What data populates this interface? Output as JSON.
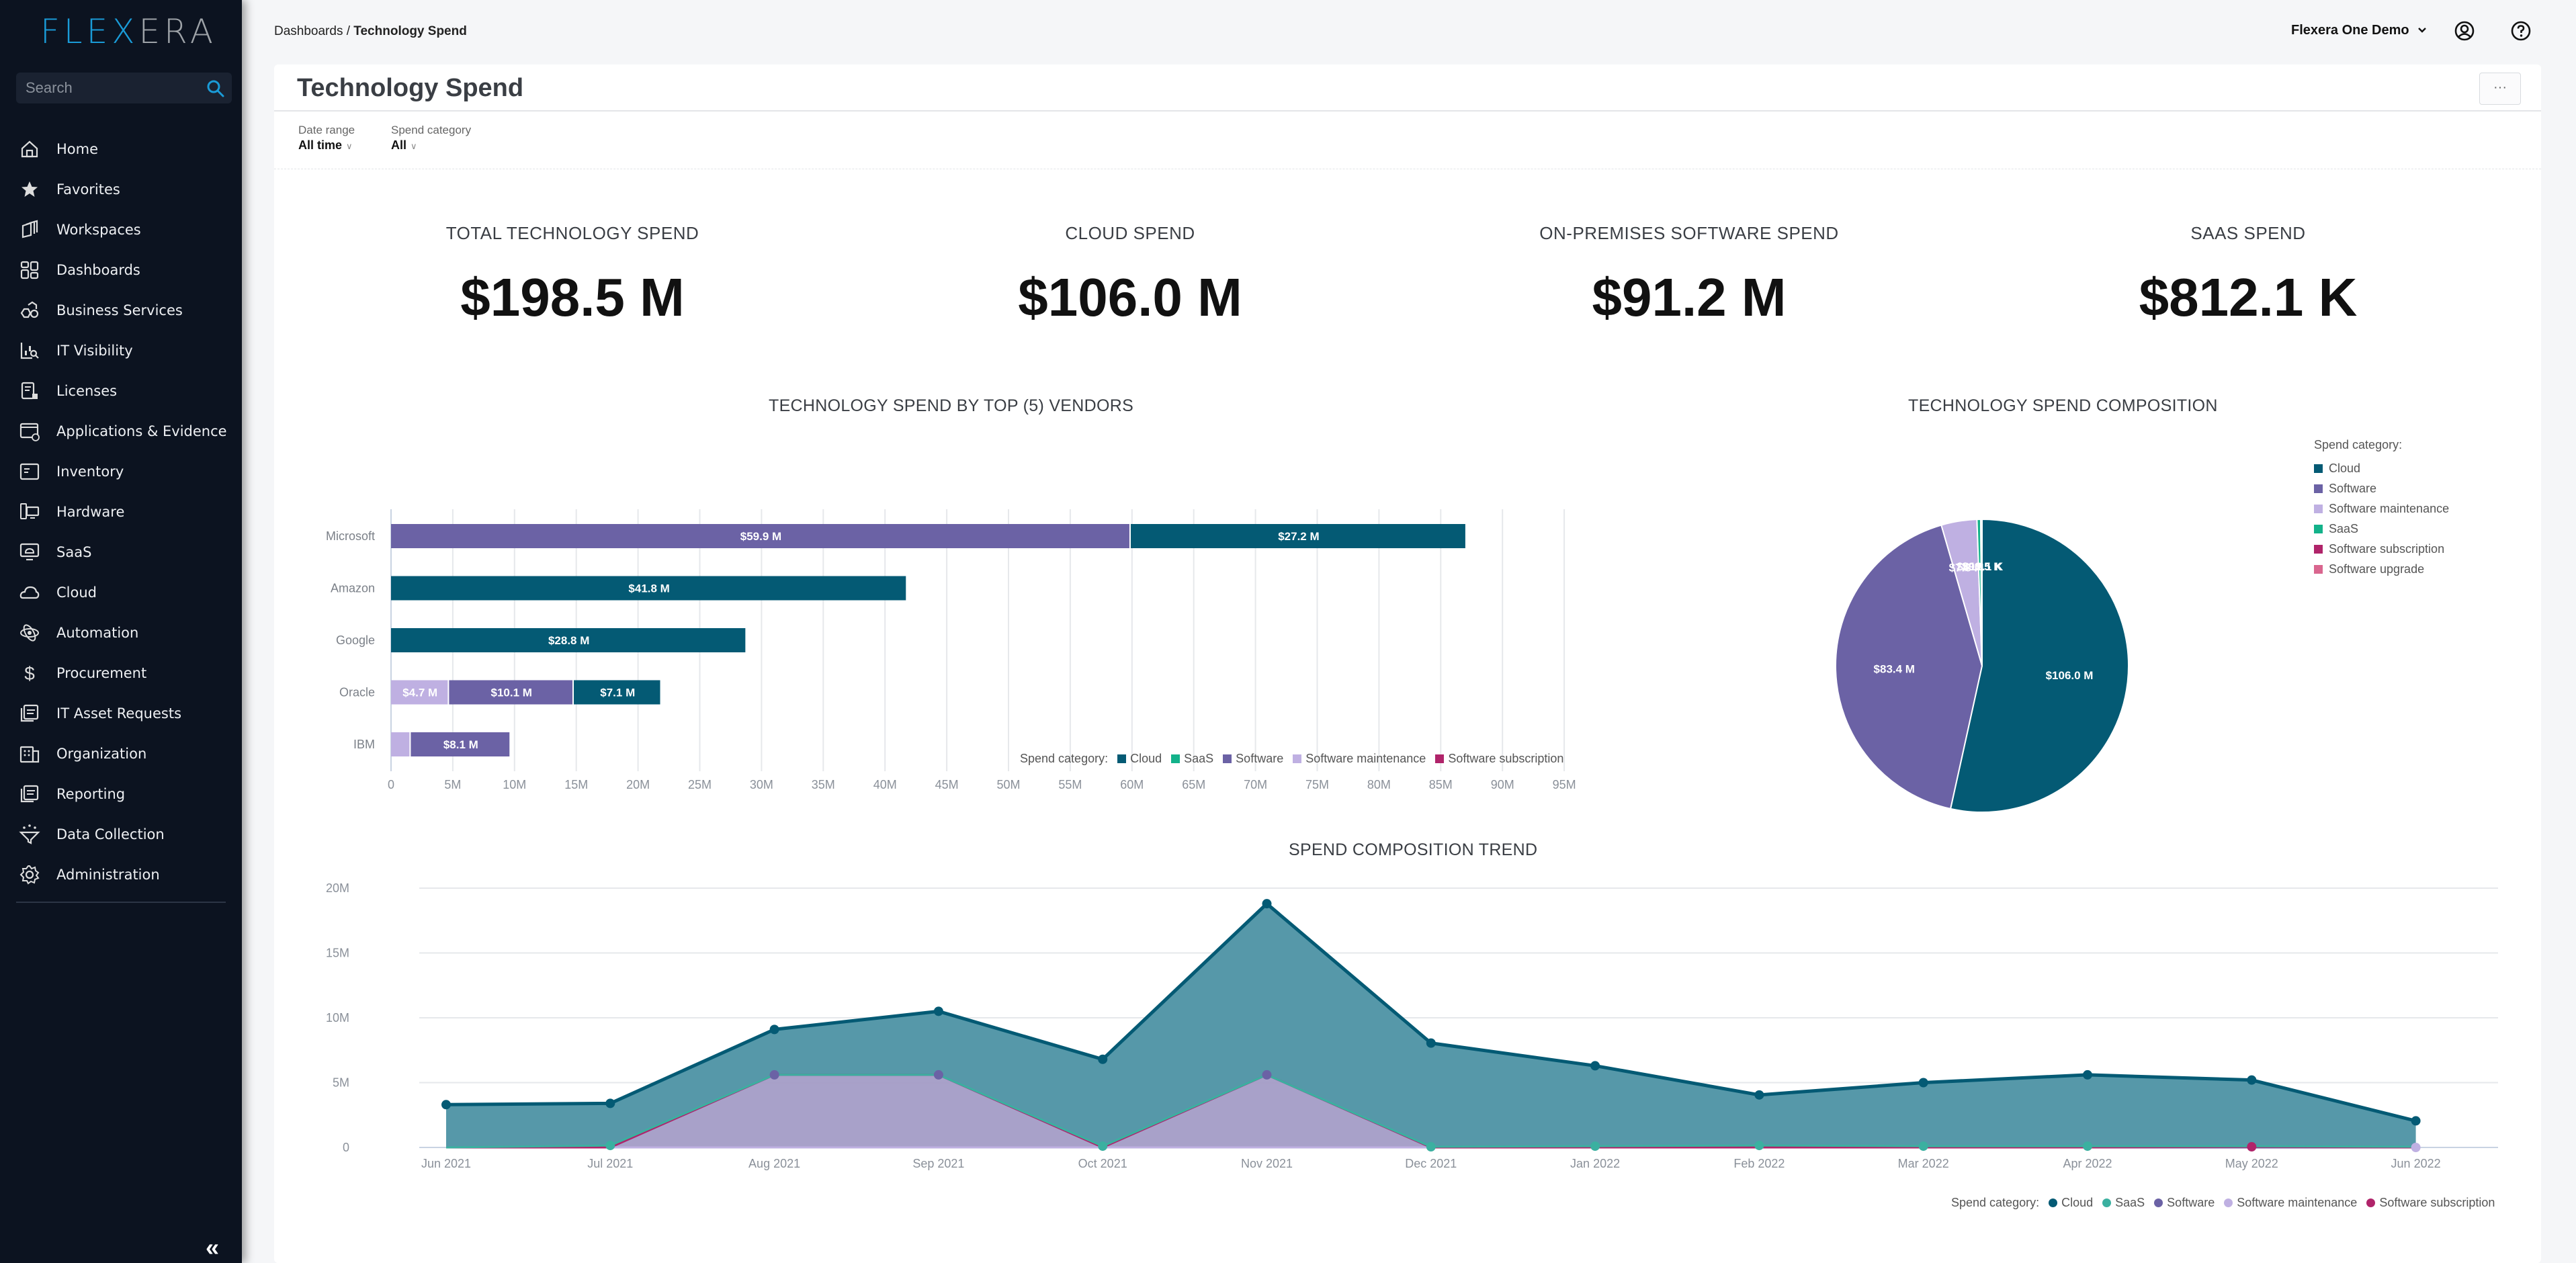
{
  "app": {
    "logo_part1": "FLEX",
    "logo_part2": "ERA"
  },
  "sidebar": {
    "search_placeholder": "Search",
    "items": [
      {
        "label": "Home",
        "icon": "home-icon"
      },
      {
        "label": "Favorites",
        "icon": "star-icon"
      },
      {
        "label": "Workspaces",
        "icon": "workspaces-icon"
      },
      {
        "label": "Dashboards",
        "icon": "dashboards-icon"
      },
      {
        "label": "Business Services",
        "icon": "business-services-icon"
      },
      {
        "label": "IT Visibility",
        "icon": "it-visibility-icon"
      },
      {
        "label": "Licenses",
        "icon": "licenses-icon"
      },
      {
        "label": "Applications & Evidence",
        "icon": "applications-icon"
      },
      {
        "label": "Inventory",
        "icon": "inventory-icon"
      },
      {
        "label": "Hardware",
        "icon": "hardware-icon"
      },
      {
        "label": "SaaS",
        "icon": "saas-icon"
      },
      {
        "label": "Cloud",
        "icon": "cloud-icon"
      },
      {
        "label": "Automation",
        "icon": "automation-icon"
      },
      {
        "label": "Procurement",
        "icon": "dollar-icon"
      },
      {
        "label": "IT Asset Requests",
        "icon": "requests-icon"
      },
      {
        "label": "Organization",
        "icon": "organization-icon"
      },
      {
        "label": "Reporting",
        "icon": "reporting-icon"
      },
      {
        "label": "Data Collection",
        "icon": "data-collection-icon"
      },
      {
        "label": "Administration",
        "icon": "gear-icon"
      }
    ],
    "collapse_label": "«"
  },
  "topbar": {
    "breadcrumb_parent": "Dashboards",
    "breadcrumb_sep": " / ",
    "breadcrumb_current": "Technology Spend",
    "org_name": "Flexera One Demo"
  },
  "page": {
    "title": "Technology Spend",
    "more_label": "···",
    "filters": [
      {
        "label": "Date range",
        "value": "All time"
      },
      {
        "label": "Spend category",
        "value": "All"
      }
    ]
  },
  "kpis": [
    {
      "label": "TOTAL TECHNOLOGY SPEND",
      "value": "$198.5 M"
    },
    {
      "label": "CLOUD SPEND",
      "value": "$106.0 M"
    },
    {
      "label": "ON-PREMISES SOFTWARE SPEND",
      "value": "$91.2 M"
    },
    {
      "label": "SAAS SPEND",
      "value": "$812.1 K"
    }
  ],
  "colors": {
    "Cloud": "#045a74",
    "SaaS": "#13b28a",
    "SaaS_trend": "#3bb0a0",
    "Software": "#6b62a5",
    "Software maintenance": "#bfb0e2",
    "Software subscription": "#b0246a",
    "Software upgrade": "#d9668f"
  },
  "chart_data": [
    {
      "type": "bar",
      "orientation": "horizontal",
      "stacked": true,
      "title": "TECHNOLOGY SPEND BY TOP (5) VENDORS",
      "categories": [
        "Microsoft",
        "Amazon",
        "Google",
        "Oracle",
        "IBM"
      ],
      "series": [
        {
          "name": "Software maintenance",
          "values": [
            0,
            0,
            0,
            4.7,
            1.6
          ],
          "labels": [
            "",
            "",
            "",
            "$4.7 M",
            ""
          ]
        },
        {
          "name": "Software",
          "values": [
            59.9,
            0,
            0,
            10.1,
            8.1
          ],
          "labels": [
            "$59.9 M",
            "",
            "",
            "$10.1 M",
            "$8.1 M"
          ]
        },
        {
          "name": "Cloud",
          "values": [
            27.2,
            41.8,
            28.8,
            7.1,
            0
          ],
          "labels": [
            "$27.2 M",
            "$41.8 M",
            "$28.8 M",
            "$7.1 M",
            ""
          ]
        }
      ],
      "units": "M",
      "xlim": [
        0,
        95
      ],
      "xticks": [
        "0",
        "5M",
        "10M",
        "15M",
        "20M",
        "25M",
        "30M",
        "35M",
        "40M",
        "45M",
        "50M",
        "55M",
        "60M",
        "65M",
        "70M",
        "75M",
        "80M",
        "85M",
        "90M",
        "95M"
      ],
      "grid": true,
      "legend_title": "Spend category:",
      "legend": [
        "Cloud",
        "SaaS",
        "Software",
        "Software maintenance",
        "Software subscription"
      ],
      "legend_position": "bottom-right"
    },
    {
      "type": "pie",
      "title": "TECHNOLOGY SPEND COMPOSITION",
      "slices": [
        {
          "name": "Cloud",
          "value": 106.0,
          "label": "$106.0 M"
        },
        {
          "name": "Software",
          "value": 83.4,
          "label": "$83.4 M"
        },
        {
          "name": "Software maintenance",
          "value": 7.8,
          "label": "$7.8 M"
        },
        {
          "name": "SaaS",
          "value": 0.8121,
          "label": "$812.1 K"
        },
        {
          "name": "Software subscription",
          "value": 0.2,
          "label": ""
        },
        {
          "name": "Software upgrade",
          "value": 0.0905,
          "label": "$90.5 K"
        }
      ],
      "units": "M",
      "legend_title": "Spend category:",
      "legend": [
        "Cloud",
        "Software",
        "Software maintenance",
        "SaaS",
        "Software subscription",
        "Software upgrade"
      ],
      "legend_position": "right"
    },
    {
      "type": "area",
      "stacked": true,
      "title": "SPEND COMPOSITION TREND",
      "x": [
        "Jun 2021",
        "Jul 2021",
        "Aug 2021",
        "Sep 2021",
        "Oct 2021",
        "Nov 2021",
        "Dec 2021",
        "Jan 2022",
        "Feb 2022",
        "Mar 2022",
        "Apr 2022",
        "May 2022",
        "Jun 2022"
      ],
      "series": [
        {
          "name": "Software maintenance",
          "values": [
            0,
            0,
            0,
            0,
            0,
            0,
            0,
            0,
            0,
            0,
            0,
            0,
            0
          ]
        },
        {
          "name": "Software",
          "values": [
            0,
            0,
            5.6,
            5.6,
            0,
            5.6,
            0,
            0,
            0,
            0,
            0,
            0,
            0
          ]
        },
        {
          "name": "Software subscription",
          "values": [
            0,
            0,
            0,
            0,
            0,
            0,
            0,
            0,
            0,
            0,
            0,
            0.05,
            0
          ]
        },
        {
          "name": "SaaS",
          "values": [
            0,
            0.15,
            0,
            0,
            0.1,
            0,
            0.05,
            0.1,
            0.15,
            0.1,
            0.1,
            0.05,
            0.05
          ]
        },
        {
          "name": "Cloud",
          "values": [
            3.3,
            3.25,
            3.5,
            4.9,
            6.7,
            13.2,
            8.0,
            6.2,
            3.9,
            4.9,
            5.5,
            5.1,
            2.0
          ]
        }
      ],
      "totals": [
        3.3,
        3.4,
        9.1,
        10.5,
        6.8,
        18.8,
        8.05,
        6.3,
        4.05,
        5.0,
        5.6,
        5.2,
        2.05
      ],
      "units": "M",
      "ylim": [
        0,
        20
      ],
      "yticks": [
        "0",
        "5M",
        "10M",
        "15M",
        "20M"
      ],
      "grid": true,
      "legend_title": "Spend category:",
      "legend": [
        "Cloud",
        "SaaS",
        "Software",
        "Software maintenance",
        "Software subscription"
      ],
      "legend_position": "bottom-right"
    }
  ]
}
